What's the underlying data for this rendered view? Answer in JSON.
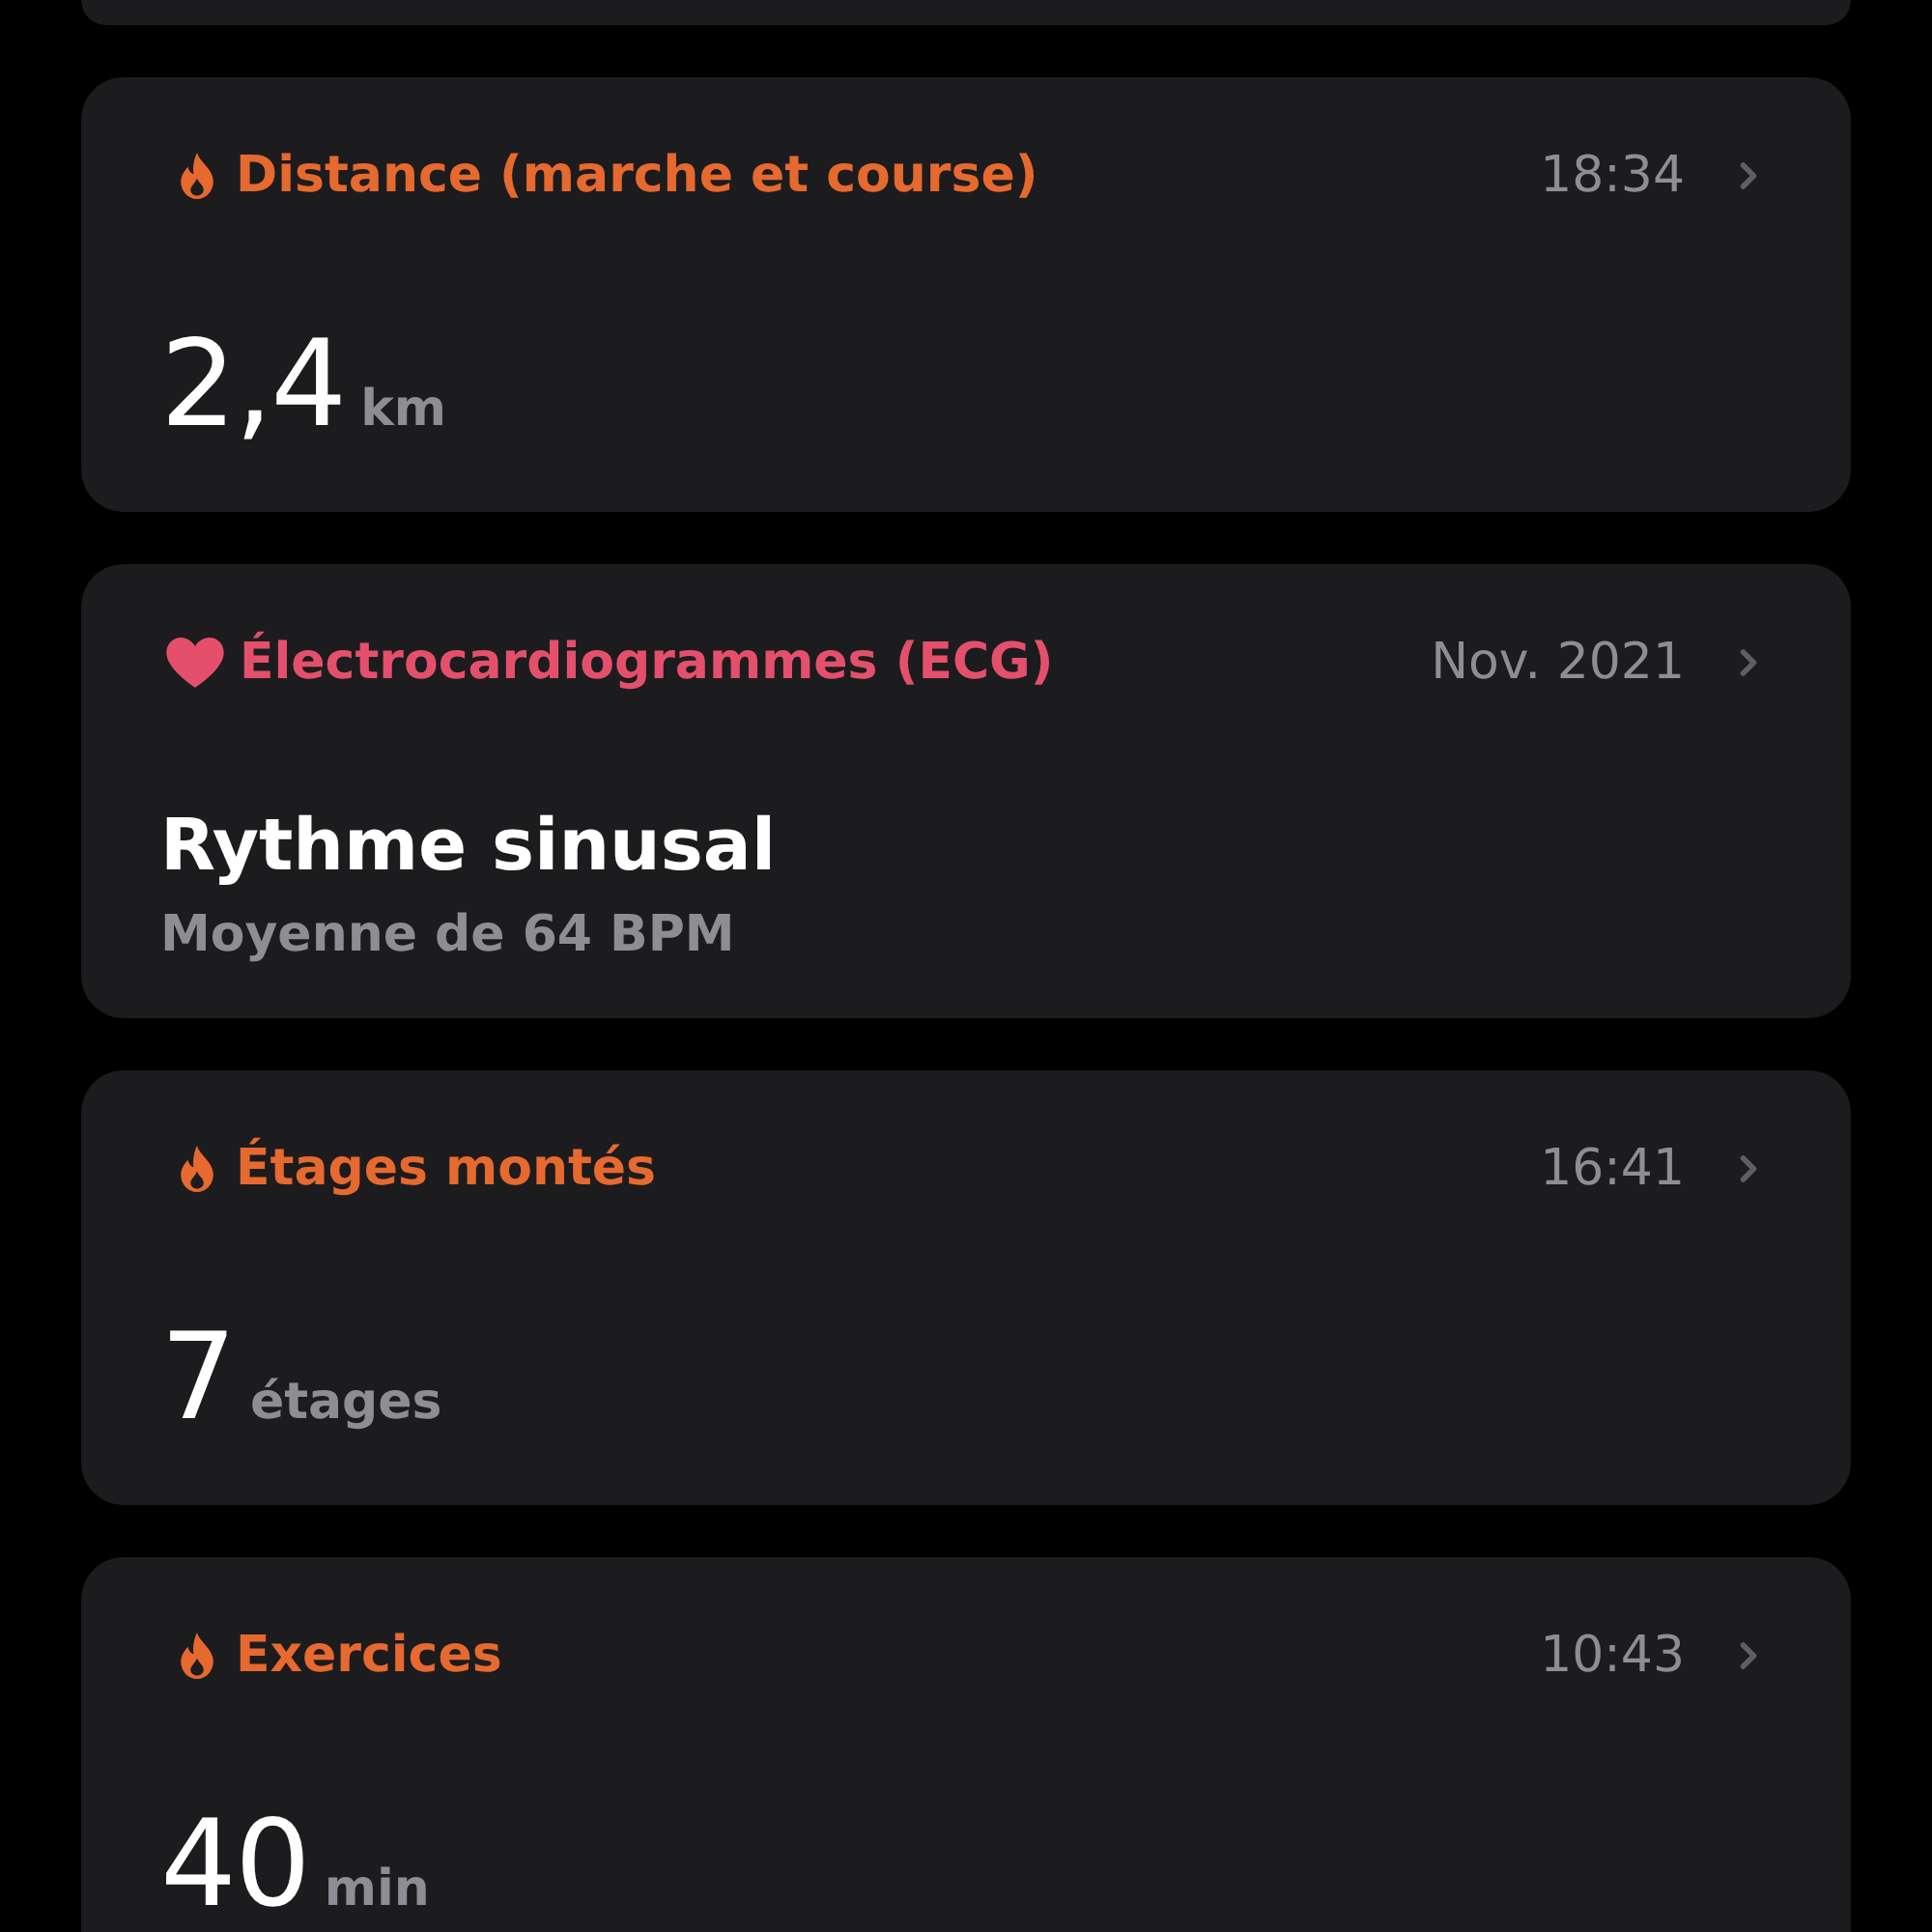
{
  "cards": [
    {
      "kind": "measurement",
      "color": "#e6692f",
      "title": "Distance (marche et course)",
      "time": "18:34",
      "value": "2,4",
      "unit": "km"
    },
    {
      "kind": "summary",
      "color": "#e4506b",
      "title": "Électrocardiogrammes (ECG)",
      "time": "Nov. 2021",
      "headline": "Rythme sinusal",
      "detail": "Moyenne de 64 BPM"
    },
    {
      "kind": "measurement",
      "color": "#e6692f",
      "title": "Étages montés",
      "time": "16:41",
      "value": "7",
      "unit": "étages"
    },
    {
      "kind": "measurement",
      "color": "#e6692f",
      "title": "Exercices",
      "time": "10:43",
      "value": "40",
      "unit": "min"
    }
  ]
}
